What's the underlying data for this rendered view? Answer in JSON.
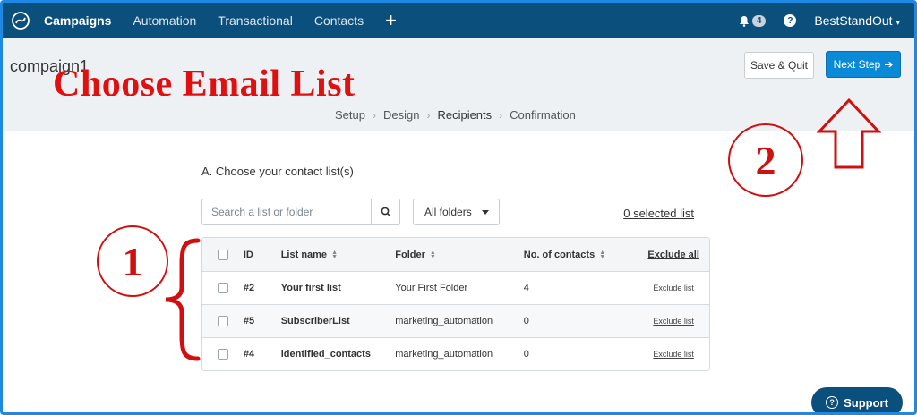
{
  "nav": {
    "items": [
      "Campaigns",
      "Automation",
      "Transactional",
      "Contacts"
    ],
    "notification_count": "4",
    "user": "BestStandOut"
  },
  "header": {
    "campaign_name": "compaign1",
    "overlay_title": "Choose Email List",
    "save_quit": "Save & Quit",
    "next_step": "Next Step"
  },
  "steps": [
    "Setup",
    "Design",
    "Recipients",
    "Confirmation"
  ],
  "contacts": {
    "section_title": "A. Choose your contact list(s)",
    "search_placeholder": "Search a list or folder",
    "folder_filter": "All folders",
    "selected_count": "0 selected list",
    "columns": {
      "id": "ID",
      "name": "List name",
      "folder": "Folder",
      "count": "No. of contacts",
      "exclude_all": "Exclude all"
    },
    "rows": [
      {
        "id": "#2",
        "name": "Your first list",
        "folder": "Your First Folder",
        "count": "4",
        "exclude": "Exclude list"
      },
      {
        "id": "#5",
        "name": "SubscriberList",
        "folder": "marketing_automation",
        "count": "0",
        "exclude": "Exclude list"
      },
      {
        "id": "#4",
        "name": "identified_contacts",
        "folder": "marketing_automation",
        "count": "0",
        "exclude": "Exclude list"
      }
    ]
  },
  "annotations": {
    "label_1": "1",
    "label_2": "2",
    "color": "#d01010"
  },
  "support_label": "Support",
  "colors": {
    "nav_bg": "#0b4f7c",
    "primary": "#0a8ad6",
    "frame": "#1e88e5"
  }
}
